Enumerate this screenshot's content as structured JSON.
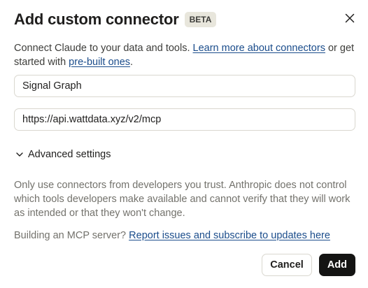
{
  "dialog": {
    "title": "Add custom connector",
    "badge": "BETA",
    "close_icon": "close-icon"
  },
  "intro": {
    "text_before_link": "Connect Claude to your data and tools. ",
    "learn_more_link": "Learn more about connectors",
    "text_between": " or get started with ",
    "prebuilt_link": "pre-built ones",
    "text_after": "."
  },
  "form": {
    "name_value": "Signal Graph",
    "url_value": "https://api.wattdata.xyz/v2/mcp"
  },
  "advanced": {
    "label": "Advanced settings",
    "icon": "chevron-down-icon"
  },
  "warning": {
    "text": "Only use connectors from developers you trust. Anthropic does not control which tools developers make available and cannot verify that they will work as intended or that they won't change."
  },
  "building": {
    "text": "Building an MCP server? ",
    "link": "Report issues and subscribe to updates here"
  },
  "actions": {
    "cancel_label": "Cancel",
    "add_label": "Add"
  },
  "colors": {
    "link": "#1a4c8b",
    "primary_button": "#141413",
    "badge_bg": "#e8e6dc",
    "muted_text": "#73726c"
  }
}
